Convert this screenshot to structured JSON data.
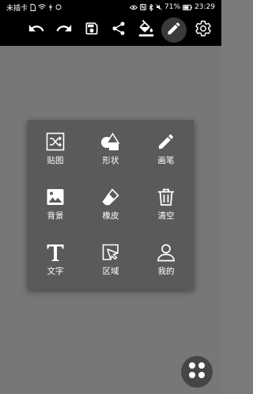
{
  "status_bar": {
    "carrier": "未插卡",
    "battery": "71%",
    "time": "23:29"
  },
  "toolbar": {
    "buttons": [
      {
        "icon": "undo-icon"
      },
      {
        "icon": "redo-icon"
      },
      {
        "icon": "save-icon"
      },
      {
        "icon": "share-icon"
      },
      {
        "icon": "fill-bucket-icon"
      },
      {
        "icon": "pencil-icon",
        "active": true
      },
      {
        "icon": "settings-icon"
      }
    ]
  },
  "menu": {
    "items": [
      {
        "label": "贴图",
        "icon": "shuffle-sticker-icon"
      },
      {
        "label": "形状",
        "icon": "shapes-icon"
      },
      {
        "label": "画笔",
        "icon": "brush-icon"
      },
      {
        "label": "背景",
        "icon": "image-icon"
      },
      {
        "label": "橡皮",
        "icon": "eraser-icon"
      },
      {
        "label": "清空",
        "icon": "trash-icon"
      },
      {
        "label": "文字",
        "icon": "text-icon"
      },
      {
        "label": "区域",
        "icon": "selection-icon"
      },
      {
        "label": "我的",
        "icon": "person-icon"
      }
    ]
  },
  "fab": {
    "icon": "grid-dots-icon"
  },
  "colors": {
    "statusbar_bg": "#000000",
    "toolbar_bg": "#000000",
    "canvas_bg": "#777777",
    "menu_bg": "#5a5a5a",
    "icon": "#ffffff"
  }
}
